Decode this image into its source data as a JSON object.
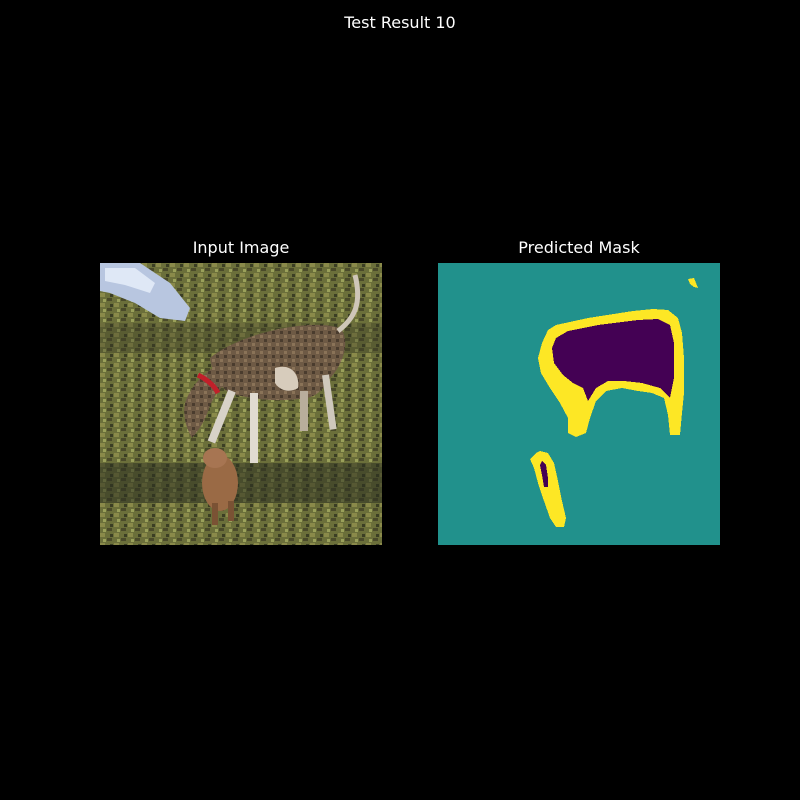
{
  "figure": {
    "title": "Test Result 10"
  },
  "panels": {
    "input": {
      "title": "Input Image",
      "content": "photo"
    },
    "mask": {
      "title": "Predicted Mask"
    }
  },
  "colors": {
    "background": "#000000",
    "text": "#ffffff",
    "mask_background": "#21918c",
    "mask_foreground": "#440154",
    "mask_boundary": "#fde725"
  }
}
